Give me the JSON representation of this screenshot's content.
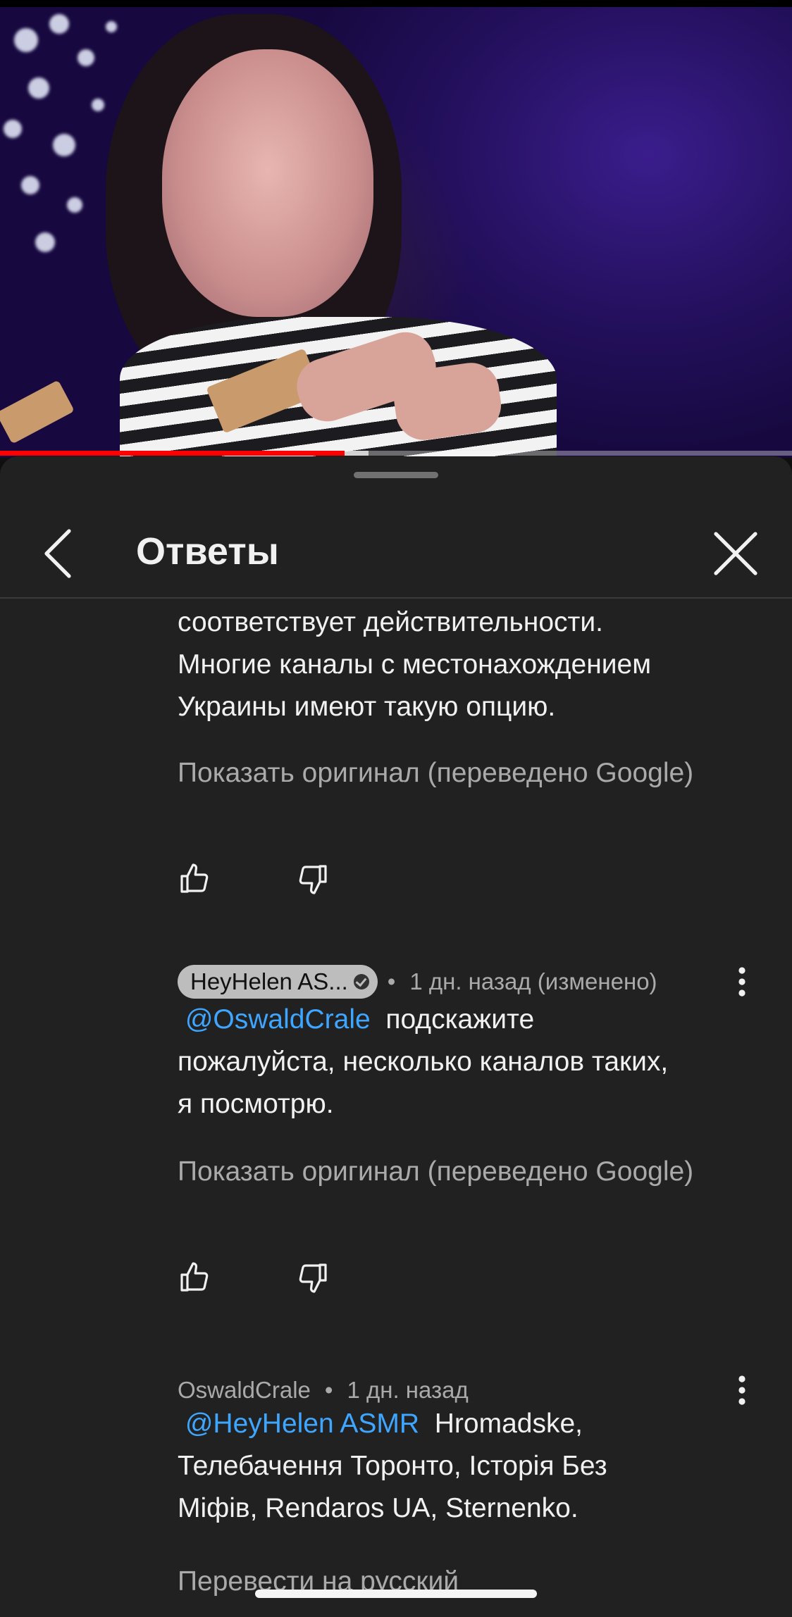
{
  "video": {
    "progress_fraction": 0.435,
    "buffered_fraction": 0.465
  },
  "sheet": {
    "title": "Ответы",
    "back_icon": "chevron-left-icon",
    "close_icon": "close-icon"
  },
  "comments": [
    {
      "lines": [
        "соответствует действительности.",
        "Многие каналы с местонахождением",
        "Украины имеют такую опцию."
      ],
      "translate_label": "Показать оригинал (переведено Google)"
    },
    {
      "author": "HeyHelen AS...",
      "time": "1 дн. назад (изменено)",
      "mention": "@OswaldCrale",
      "line1_rest": "подскажите",
      "lines": [
        "пожалуйста, несколько каналов таких,",
        "я посмотрю."
      ],
      "translate_label": "Показать оригинал (переведено Google)"
    },
    {
      "author": "OswaldCrale",
      "time": "1 дн. назад",
      "mention": "@HeyHelen ASMR",
      "line1_rest": "Hromadske,",
      "lines": [
        "Телебачення Торонто, Історія Без",
        "Міфів, Rendaros UA, Sternenko."
      ],
      "translate_label": "Перевести на русский"
    }
  ],
  "separator": "•",
  "colors": {
    "sheet_bg": "#212121",
    "mention": "#3ea6ff",
    "progress": "#ff0000",
    "secondary_text": "#aaaaaa"
  }
}
